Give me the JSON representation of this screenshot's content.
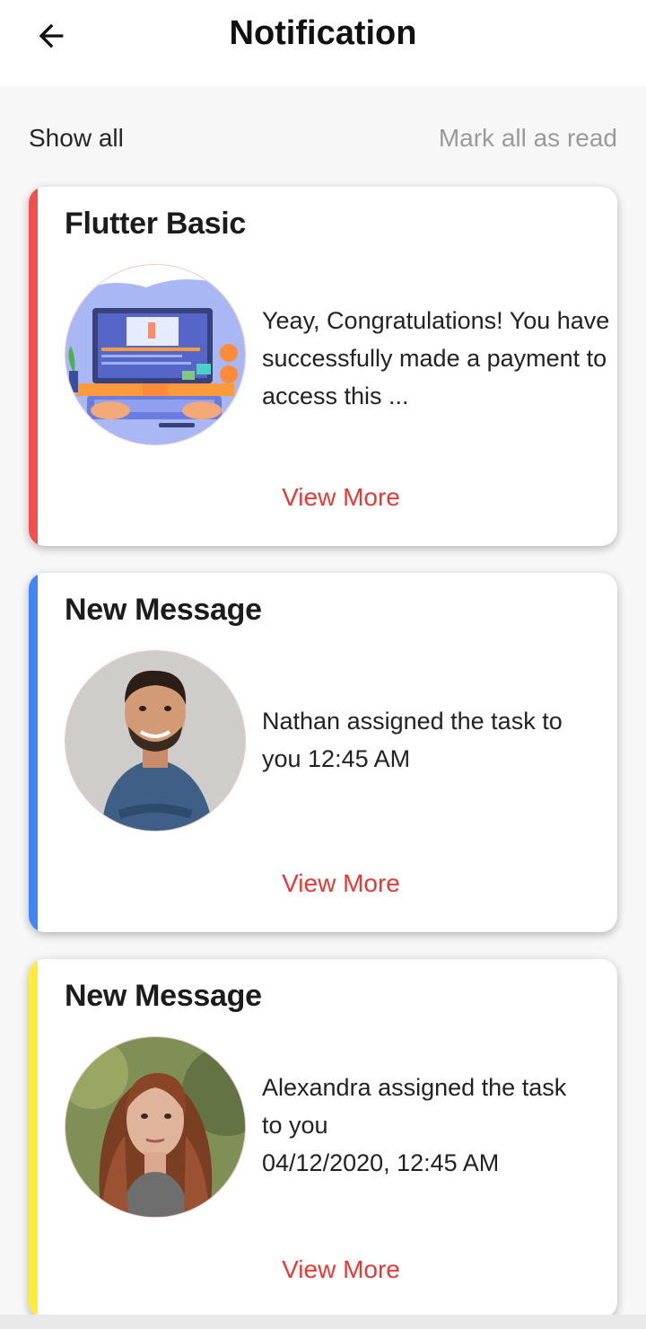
{
  "header": {
    "title": "Notification",
    "back_icon": "arrow-left-icon"
  },
  "actions": {
    "show_all": "Show all",
    "mark_all_read": "Mark all as read"
  },
  "notifications": [
    {
      "title": "Flutter Basic",
      "body": "Yeay, Congratulations! You have successfully made a payment to access this ...",
      "accent_color": "#f0504f",
      "image": "course-illustration",
      "action": "View More"
    },
    {
      "title": "New Message",
      "body_line1": "Nathan assigned the task to",
      "body_line2": "you 12:45 AM",
      "accent_color": "#4285f4",
      "image": "nathan-avatar",
      "action": "View More"
    },
    {
      "title": "New Message",
      "body_line1": "Alexandra assigned the task",
      "body_line2": "to you",
      "body_line3": "04/12/2020, 12:45 AM",
      "accent_color": "#ffeb3b",
      "image": "alexandra-avatar",
      "action": "View More"
    }
  ],
  "colors": {
    "link_red": "#e53935",
    "muted_gray": "#9a9a9a"
  }
}
